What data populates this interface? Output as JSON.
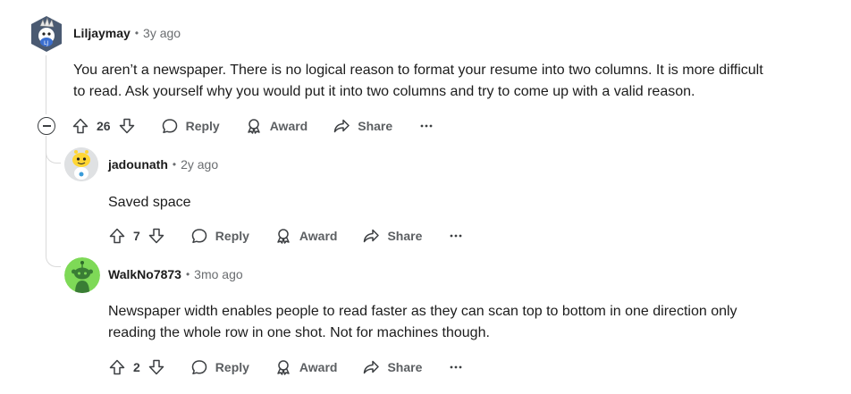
{
  "comments": [
    {
      "username": "Liljaymay",
      "separator": "•",
      "time": "3y ago",
      "body_lines": [
        "You aren’t a newspaper. There is no logical reason to format your resume into two columns. It is more difficult",
        "to read. Ask yourself why you would put it into two columns and try to come up with a valid reason."
      ],
      "score": "26",
      "avatar_icon": "snoo-avatar-icon"
    },
    {
      "username": "jadounath",
      "separator": "•",
      "time": "2y ago",
      "body_lines": [
        "Saved space"
      ],
      "score": "7",
      "avatar_icon": "snoo-avatar-icon"
    },
    {
      "username": "WalkNo7873",
      "separator": "•",
      "time": "3mo ago",
      "body_lines": [
        "Newspaper width enables people to read faster as they can scan top to bottom in one direction only",
        "reading the whole row in one shot. Not for machines though."
      ],
      "score": "2",
      "avatar_icon": "snoo-avatar-icon"
    }
  ],
  "actions": {
    "reply": "Reply",
    "award": "Award",
    "share": "Share",
    "more": "···"
  },
  "colors": {
    "text": "#1c1c1c",
    "meta": "#6a6d70",
    "thread_line": "#dadada",
    "avatar_green": "#7ed957"
  }
}
